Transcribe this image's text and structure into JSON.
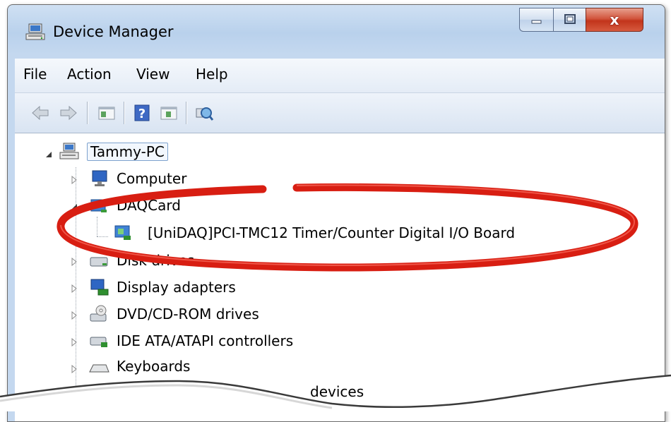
{
  "window": {
    "title": "Device Manager",
    "title_icon": "device-manager-icon"
  },
  "caption_buttons": {
    "minimize_icon": "minimize-icon",
    "maximize_icon": "maximize-icon",
    "close_label": "x"
  },
  "menu": {
    "items": [
      {
        "label": "File"
      },
      {
        "label": "Action"
      },
      {
        "label": "View"
      },
      {
        "label": "Help"
      }
    ]
  },
  "toolbar": {
    "buttons": [
      {
        "icon": "back-arrow-icon"
      },
      {
        "icon": "forward-arrow-icon"
      },
      {
        "icon": "console-tree-icon"
      },
      {
        "icon": "help-icon",
        "label": "?"
      },
      {
        "icon": "action-pane-icon"
      },
      {
        "icon": "scan-hardware-icon"
      }
    ]
  },
  "tree": {
    "root": {
      "label": "Tammy-PC",
      "icon": "computer-network-icon",
      "expanded": true
    },
    "items": [
      {
        "label": "Computer",
        "icon": "monitor-icon",
        "expanded": false
      },
      {
        "label": "DAQCard",
        "icon": "daq-card-icon",
        "expanded": true
      },
      {
        "label": "[UniDAQ]PCI-TMC12 Timer/Counter Digital I/O Board",
        "icon": "daq-board-icon",
        "child": true
      },
      {
        "label": "Disk drives",
        "icon": "disk-drive-icon",
        "expanded": false
      },
      {
        "label": "Display adapters",
        "icon": "display-adapter-icon",
        "expanded": false
      },
      {
        "label": "DVD/CD-ROM drives",
        "icon": "dvd-drive-icon",
        "expanded": false
      },
      {
        "label": "IDE ATA/ATAPI controllers",
        "icon": "ide-controller-icon",
        "expanded": false
      },
      {
        "label": "Keyboards",
        "icon": "keyboard-icon",
        "expanded": false
      },
      {
        "label": "devices",
        "icon": "",
        "expanded": false
      }
    ]
  },
  "colors": {
    "annotation_ring": "#d81e12",
    "selection_border": "#7da2ce",
    "titlebar": "#c4d8ef"
  }
}
